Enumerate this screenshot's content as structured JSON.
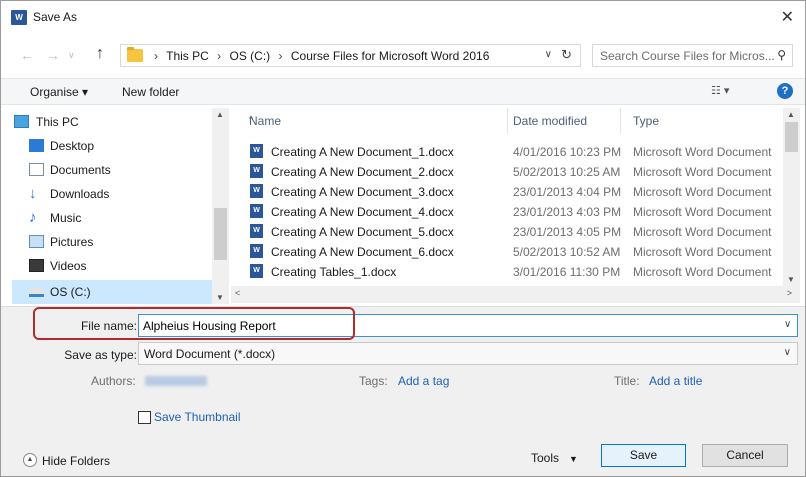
{
  "window": {
    "app_icon_text": "W",
    "title": "Save As",
    "close_glyph": "✕"
  },
  "address": {
    "back_glyph": "←",
    "forward_glyph": "→",
    "recent_glyph": "∨",
    "up_glyph": "↑",
    "crumbs": [
      "This PC",
      "OS (C:)",
      "Course Files for Microsoft Word 2016"
    ],
    "crumb_separator": "›",
    "dropdown_glyph": "∨",
    "refresh_glyph": "↻"
  },
  "search": {
    "placeholder": "Search Course Files for Micros...",
    "icon_glyph": "⚲"
  },
  "toolbar": {
    "organise_label": "Organise ▾",
    "new_folder_label": "New folder",
    "view_glyph": "☷ ▾",
    "help_glyph": "?"
  },
  "nav_pane": {
    "items": [
      {
        "label": "This PC",
        "icon": "computer-icon"
      },
      {
        "label": "Desktop",
        "icon": "desktop-icon"
      },
      {
        "label": "Documents",
        "icon": "documents-icon"
      },
      {
        "label": "Downloads",
        "icon": "downloads-icon"
      },
      {
        "label": "Music",
        "icon": "music-icon"
      },
      {
        "label": "Pictures",
        "icon": "pictures-icon"
      },
      {
        "label": "Videos",
        "icon": "videos-icon"
      },
      {
        "label": "OS (C:)",
        "icon": "drive-icon"
      }
    ],
    "selected": "OS (C:)"
  },
  "file_list": {
    "columns": {
      "name": "Name",
      "date": "Date modified",
      "type": "Type"
    },
    "sort_glyph": "^",
    "files": [
      {
        "name": "Creating A New Document_1.docx",
        "date": "4/01/2016 10:23 PM",
        "type": "Microsoft Word Document"
      },
      {
        "name": "Creating A New Document_2.docx",
        "date": "5/02/2013 10:25 AM",
        "type": "Microsoft Word Document"
      },
      {
        "name": "Creating A New Document_3.docx",
        "date": "23/01/2013 4:04 PM",
        "type": "Microsoft Word Document"
      },
      {
        "name": "Creating A New Document_4.docx",
        "date": "23/01/2013 4:03 PM",
        "type": "Microsoft Word Document"
      },
      {
        "name": "Creating A New Document_5.docx",
        "date": "23/01/2013 4:05 PM",
        "type": "Microsoft Word Document"
      },
      {
        "name": "Creating A New Document_6.docx",
        "date": "5/02/2013 10:52 AM",
        "type": "Microsoft Word Document"
      },
      {
        "name": "Creating Tables_1.docx",
        "date": "3/01/2016 11:30 PM",
        "type": "Microsoft Word Document"
      }
    ]
  },
  "scroll": {
    "up": "▲",
    "down": "▼",
    "left": "<",
    "right": ">"
  },
  "form": {
    "file_name_label": "File name:",
    "file_name_value": "Alpheius Housing Report",
    "save_as_type_label": "Save as type:",
    "save_as_type_value": "Word Document (*.docx)",
    "dropdown_glyph": "∨",
    "authors_label": "Authors:",
    "authors_value": "Cara Hemphill",
    "tags_label": "Tags:",
    "tags_link": "Add a tag",
    "title_label": "Title:",
    "title_link": "Add a title",
    "save_thumbnail_label": "Save Thumbnail",
    "save_thumbnail_checked": false
  },
  "footer": {
    "hide_folders_label": "Hide Folders",
    "hide_folders_glyph": "▲",
    "tools_label": "Tools",
    "tools_caret": "▼",
    "save_label": "Save",
    "cancel_label": "Cancel"
  },
  "colors": {
    "accent": "#0078d7",
    "highlight_annotation": "#b02d2d",
    "selection": "#cce8ff",
    "link": "#1f5fb5"
  }
}
